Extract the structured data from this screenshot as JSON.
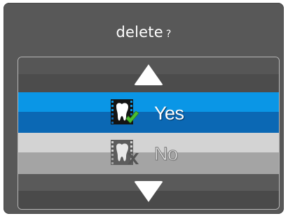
{
  "dialog": {
    "title": "delete",
    "title_mark": "?"
  },
  "picker": {
    "up_arrow_icon": "triangle-up-icon",
    "down_arrow_icon": "triangle-down-icon",
    "options": [
      {
        "label": "Yes",
        "icon": "tooth-check-icon",
        "selected": true
      },
      {
        "label": "No",
        "icon": "tooth-cross-icon",
        "selected": false
      }
    ]
  },
  "colors": {
    "dialog_bg": "#585858",
    "selected_top": "#0a96e6",
    "selected_bottom": "#0b68b4",
    "unselected_top": "#d3d3d3",
    "unselected_bottom": "#a4a4a4",
    "check": "#4cbd2e",
    "cross": "#5a5a5a"
  }
}
